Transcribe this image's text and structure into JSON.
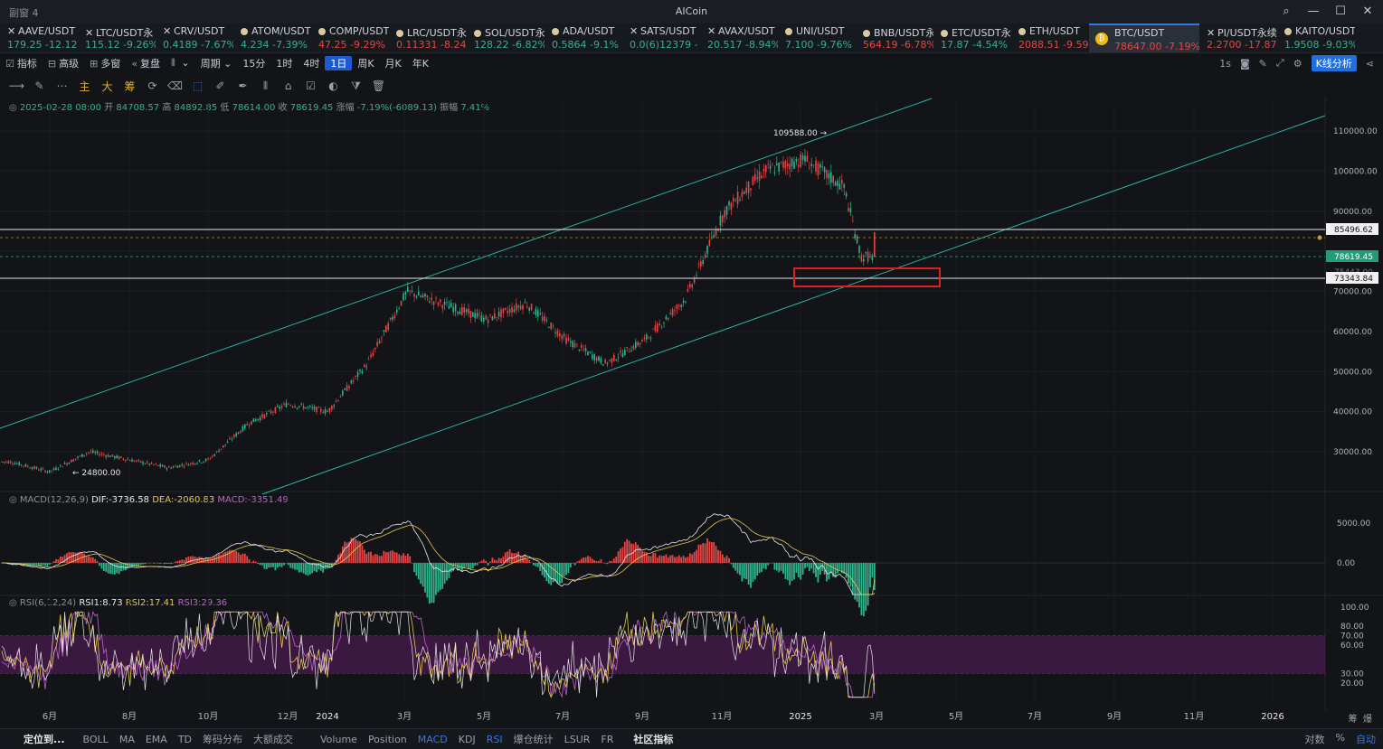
{
  "window": {
    "tab_label": "副窗 4",
    "title": "AICoin"
  },
  "tickers": [
    {
      "icon": "close",
      "name": "AAVE/USDT",
      "price": "179.25",
      "change": "-12.12",
      "dir": "up"
    },
    {
      "icon": "close",
      "name": "LTC/USDT永",
      "price": "115.12",
      "change": "-9.26%",
      "dir": "up"
    },
    {
      "icon": "close",
      "name": "CRV/USDT",
      "price": "0.4189",
      "change": "-7.67%",
      "dir": "up"
    },
    {
      "icon": "dot",
      "name": "ATOM/USDT",
      "price": "4.234",
      "change": "-7.39%",
      "dir": "up"
    },
    {
      "icon": "dot",
      "name": "COMP/USDT",
      "price": "47.25",
      "change": "-9.29%",
      "dir": "dn"
    },
    {
      "icon": "dot",
      "name": "LRC/USDT永",
      "price": "0.11331",
      "change": "-8.24",
      "dir": "dn"
    },
    {
      "icon": "dot",
      "name": "SOL/USDT永",
      "price": "128.22",
      "change": "-6.82%",
      "dir": "up"
    },
    {
      "icon": "dot",
      "name": "ADA/USDT",
      "price": "0.5864",
      "change": "-9.1%",
      "dir": "up"
    },
    {
      "icon": "close",
      "name": "SATS/USDT",
      "price": "0.0(6)12379",
      "change": "-",
      "dir": "up"
    },
    {
      "icon": "close",
      "name": "AVAX/USDT",
      "price": "20.517",
      "change": "-8.94%",
      "dir": "up"
    },
    {
      "icon": "dot",
      "name": "UNI/USDT",
      "price": "7.100",
      "change": "-9.76%",
      "dir": "up"
    },
    {
      "icon": "dot",
      "name": "BNB/USDT永",
      "price": "564.19",
      "change": "-6.78%",
      "dir": "dn"
    },
    {
      "icon": "dot",
      "name": "ETC/USDT永",
      "price": "17.87",
      "change": "-4.54%",
      "dir": "up"
    },
    {
      "icon": "dot",
      "name": "ETH/USDT",
      "price": "2088.51",
      "change": "-9.59",
      "dir": "dn"
    },
    {
      "icon": "coin",
      "name": "BTC/USDT",
      "price": "78647.00",
      "change": "-7.19%",
      "dir": "dn",
      "active": true
    },
    {
      "icon": "close",
      "name": "PI/USDT永续",
      "price": "2.2700",
      "change": "-17.87",
      "dir": "dn"
    },
    {
      "icon": "dot",
      "name": "KAITO/USDT",
      "price": "1.9508",
      "change": "-9.03%",
      "dir": "up"
    }
  ],
  "toolbar": {
    "items": [
      "指标",
      "高级",
      "多窗",
      "复盘",
      "",
      "周期",
      "15分",
      "1时",
      "4时",
      "1日",
      "周K",
      "月K",
      "年K"
    ],
    "selected": "1日",
    "right_interval": "1s",
    "k_analysis": "K线分析"
  },
  "drawtools": {
    "main": "主",
    "big": "大",
    "chip": "筹"
  },
  "info": {
    "date": "2025-02-28 08:00",
    "open_label": "开",
    "open": "84708.57",
    "high_label": "高",
    "high": "84892.85",
    "low_label": "低",
    "low": "78614.00",
    "close_label": "收",
    "close": "78619.45",
    "chg_label": "涨幅",
    "chg": "-7.19%(-6089.13)",
    "amp_label": "振幅",
    "amp": "7.41%"
  },
  "macd": {
    "label": "MACD(12,26,9)",
    "dif": "DIF:-3736.58",
    "dea": "DEA:-2060.83",
    "macd": "MACD:-3351.49"
  },
  "rsi": {
    "label": "RSI(6,12,24)",
    "rsi1": "RSI1:8.73",
    "rsi2": "RSI2:17.41",
    "rsi3": "RSI3:29.36"
  },
  "price_axis": [
    "110000.00",
    "100000.00",
    "90000.00",
    "70000.00",
    "60000.00",
    "50000.00",
    "40000.00",
    "30000.00"
  ],
  "price_tags": {
    "line_upper": "85496.62",
    "current": "78619.45",
    "hidden": "75443.00",
    "line_lower": "73343.84"
  },
  "annotations": {
    "high": "109588.00",
    "low": "24800.00"
  },
  "macd_axis": [
    "5000.00",
    "0.00"
  ],
  "rsi_axis": [
    "100.00",
    "80.00",
    "70.00",
    "60.00",
    "30.00",
    "20.00"
  ],
  "x_labels": [
    "6月",
    "8月",
    "10月",
    "12月",
    "2024",
    "3月",
    "5月",
    "7月",
    "9月",
    "11月",
    "2025",
    "3月",
    "5月",
    "7月",
    "9月",
    "11月",
    "2026"
  ],
  "bottom_tabs": [
    "定位到...",
    "BOLL",
    "MA",
    "EMA",
    "TD",
    "筹码分布",
    "大额成交",
    "Volume",
    "Position",
    "MACD",
    "KDJ",
    "RSI",
    "爆仓统计",
    "LSUR",
    "FR",
    "社区指标"
  ],
  "bottom_selected": [
    "MACD",
    "RSI"
  ],
  "bottom_right": {
    "log": "对数",
    "pct": "%",
    "auto": "自动"
  },
  "top_right_corner": {
    "a": "筹",
    "b": "爆"
  },
  "chart_data": {
    "type": "candlestick",
    "symbol": "BTC/USDT",
    "interval": "1D",
    "ylim": [
      20000,
      115000
    ],
    "ohlc_key_points": [
      {
        "t": "2023-05",
        "price": 27500
      },
      {
        "t": "2023-06",
        "price": 25000
      },
      {
        "t": "2023-07",
        "price": 30000
      },
      {
        "t": "2023-09",
        "price": 26000
      },
      {
        "t": "2023-10",
        "price": 28000
      },
      {
        "t": "2023-11",
        "price": 37000
      },
      {
        "t": "2023-12",
        "price": 42000
      },
      {
        "t": "2024-01",
        "price": 40000
      },
      {
        "t": "2024-02",
        "price": 52000
      },
      {
        "t": "2024-03",
        "price": 70000
      },
      {
        "t": "2024-05",
        "price": 63000
      },
      {
        "t": "2024-06",
        "price": 67000
      },
      {
        "t": "2024-07",
        "price": 58000
      },
      {
        "t": "2024-08",
        "price": 52000
      },
      {
        "t": "2024-09",
        "price": 58000
      },
      {
        "t": "2024-10",
        "price": 68000
      },
      {
        "t": "2024-11",
        "price": 90000
      },
      {
        "t": "2024-12",
        "price": 100000
      },
      {
        "t": "2025-01",
        "price": 103000
      },
      {
        "t": "2025-02",
        "price": 96000
      },
      {
        "t": "2025-02-28",
        "price": 78619.45
      }
    ],
    "rsi_bands": [
      30,
      70
    ]
  },
  "colors": {
    "up": "#2fb58e",
    "down": "#e84545",
    "accent": "#2c7be5",
    "channel": "#2ab3a3",
    "zone": "#e02020",
    "rsi_band": "#4a1a4e"
  }
}
